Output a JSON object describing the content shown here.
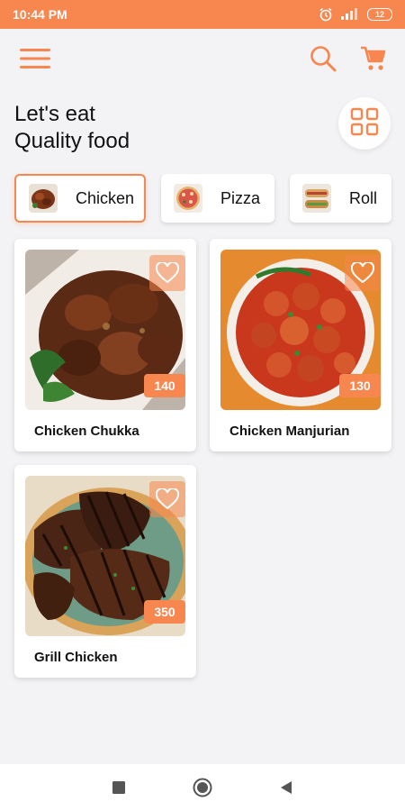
{
  "status_bar": {
    "time": "10:44 PM",
    "battery": "12",
    "icons": [
      "alarm-icon",
      "signal-icon",
      "battery-icon"
    ]
  },
  "app_bar": {
    "icons": [
      "menu-icon",
      "search-icon",
      "cart-icon"
    ]
  },
  "heading": {
    "line1": "Let's eat",
    "line2": "Quality food"
  },
  "categories": [
    {
      "label": "Chicken",
      "selected": true
    },
    {
      "label": "Pizza",
      "selected": false
    },
    {
      "label": "Roll",
      "selected": false
    }
  ],
  "foods": [
    {
      "name": "Chicken Chukka",
      "price": "140"
    },
    {
      "name": "Chicken Manjurian",
      "price": "130"
    },
    {
      "name": "Grill Chicken",
      "price": "350"
    }
  ],
  "nav_bar": {
    "icons": [
      "recents-icon",
      "home-icon",
      "back-icon"
    ]
  },
  "colors": {
    "accent": "#f7864f",
    "background": "#f3f3f6",
    "card": "#ffffff"
  }
}
